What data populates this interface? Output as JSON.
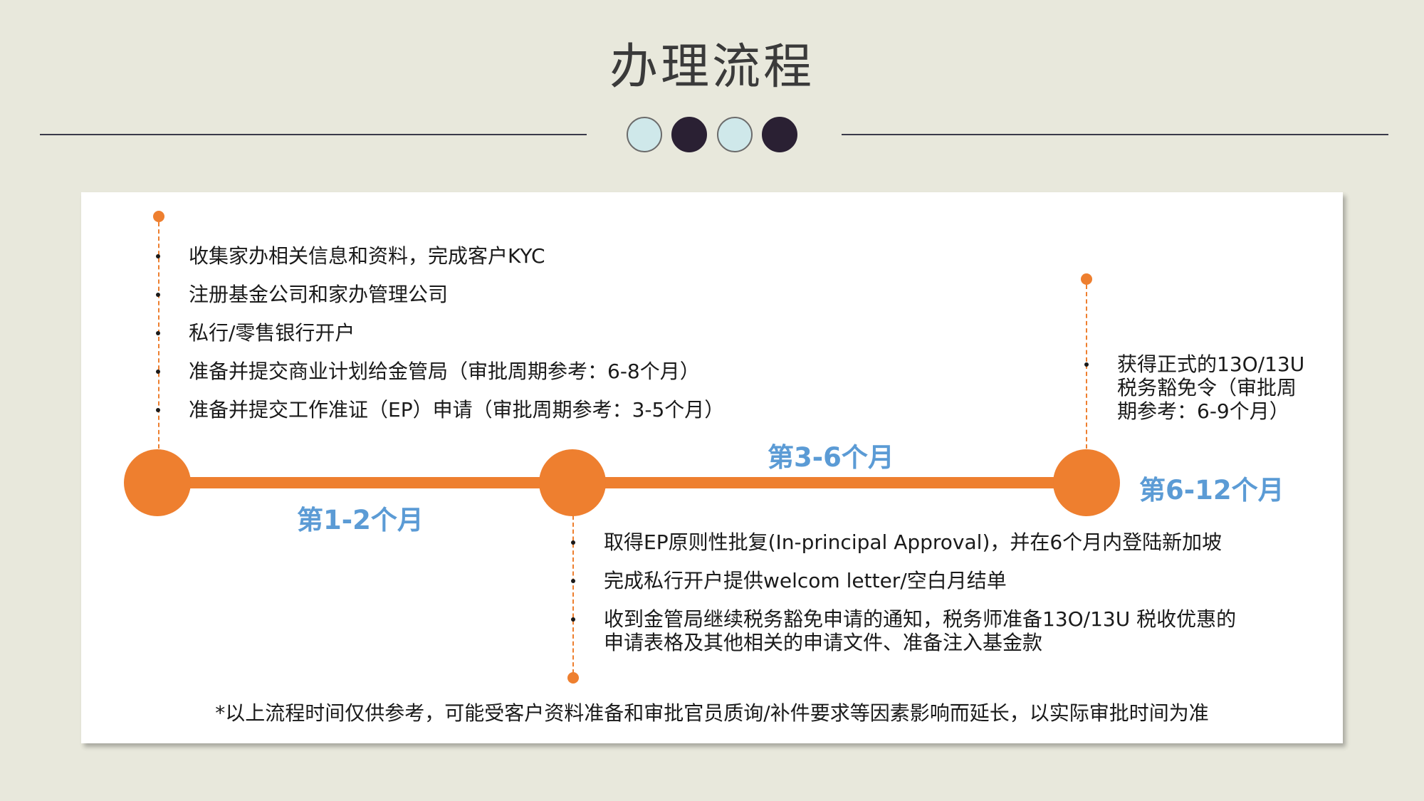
{
  "title": "办理流程",
  "colors": {
    "accent": "#ee7f2f",
    "phase_label": "#5b9bd5",
    "background": "#e8e8dc",
    "dot_light": "#cfe8ea",
    "dot_dark": "#2a2033"
  },
  "phases": [
    {
      "label": "第1-2个月",
      "items": [
        "收集家办相关信息和资料，完成客户KYC",
        "注册基金公司和家办管理公司",
        "私行/零售银行开户",
        "准备并提交商业计划给金管局（审批周期参考：6-8个月）",
        "准备并提交工作准证（EP）申请（审批周期参考：3-5个月）"
      ]
    },
    {
      "label": "第3-6个月",
      "items": [
        "取得EP原则性批复(In-principal Approval)，并在6个月内登陆新加坡",
        "完成私行开户提供welcom letter/空白月结单",
        "收到金管局继续税务豁免申请的通知，税务师准备13O/13U   税收优惠的\n申请表格及其他相关的申请文件、准备注入基金款"
      ]
    },
    {
      "label": "第6-12个月",
      "items": [
        "获得正式的13O/13U\n税务豁免令（审批周\n期参考：6-9个月）"
      ]
    }
  ],
  "footnote": "*以上流程时间仅供参考，可能受客户资料准备和审批官员质询/补件要求等因素影响而延长，以实际审批时间为准"
}
